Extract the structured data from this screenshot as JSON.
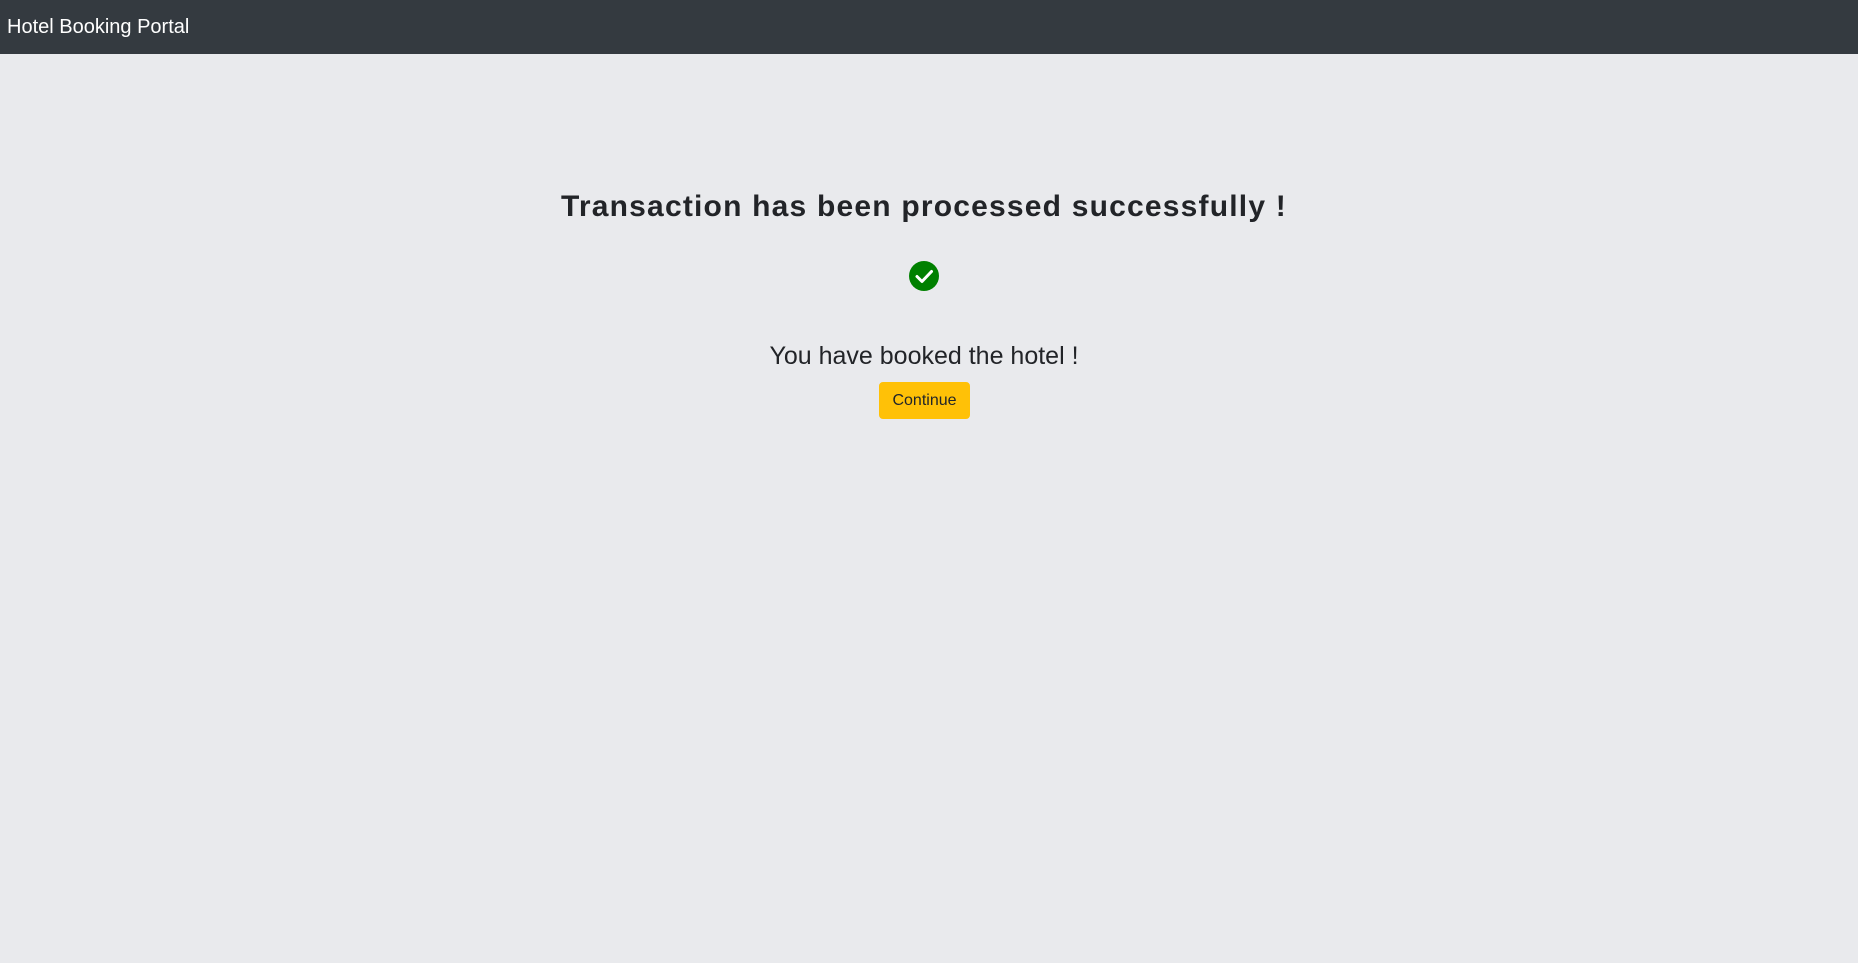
{
  "navbar": {
    "brand": "Hotel Booking Portal"
  },
  "confirmation": {
    "heading": "Transaction has been processed successfully !",
    "message": "You have booked the hotel !",
    "continue_label": "Continue",
    "icon": "check-circle-icon"
  },
  "colors": {
    "navbar_bg": "#343a40",
    "page_bg": "#e9eaed",
    "success": "#008000",
    "button": "#ffc107"
  }
}
